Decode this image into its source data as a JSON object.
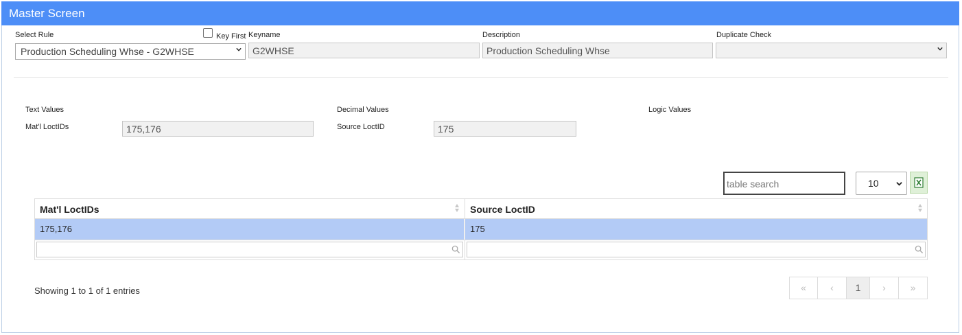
{
  "header": {
    "title": "Master Screen"
  },
  "form": {
    "select_rule_label": "Select Rule",
    "select_rule_value": "Production Scheduling Whse - G2WHSE",
    "key_first_label": "Key First",
    "keyname_label": "Keyname",
    "keyname_value": "G2WHSE",
    "description_label": "Description",
    "description_value": "Production Scheduling Whse",
    "duplicate_check_label": "Duplicate Check",
    "duplicate_check_value": ""
  },
  "values": {
    "text_values_label": "Text Values",
    "decimal_values_label": "Decimal Values",
    "logic_values_label": "Logic Values",
    "matl_label": "Mat'l LoctIDs",
    "matl_value": "175,176",
    "source_label": "Source LoctID",
    "source_value": "175"
  },
  "table": {
    "search_placeholder": "table search",
    "page_length": "10",
    "columns": [
      "Mat'l LoctIDs",
      "Source LoctID"
    ],
    "rows": [
      [
        "175,176",
        "175"
      ]
    ],
    "info": "Showing 1 to 1 of 1 entries",
    "pagination": {
      "first": "«",
      "prev": "‹",
      "current": "1",
      "next": "›",
      "last": "»"
    }
  },
  "colors": {
    "header": "#4d8ef7",
    "selected_row": "#b3cbf6"
  },
  "icons": [
    "excel-export-icon",
    "sort-icon",
    "search-icon",
    "chevron-down-icon"
  ]
}
